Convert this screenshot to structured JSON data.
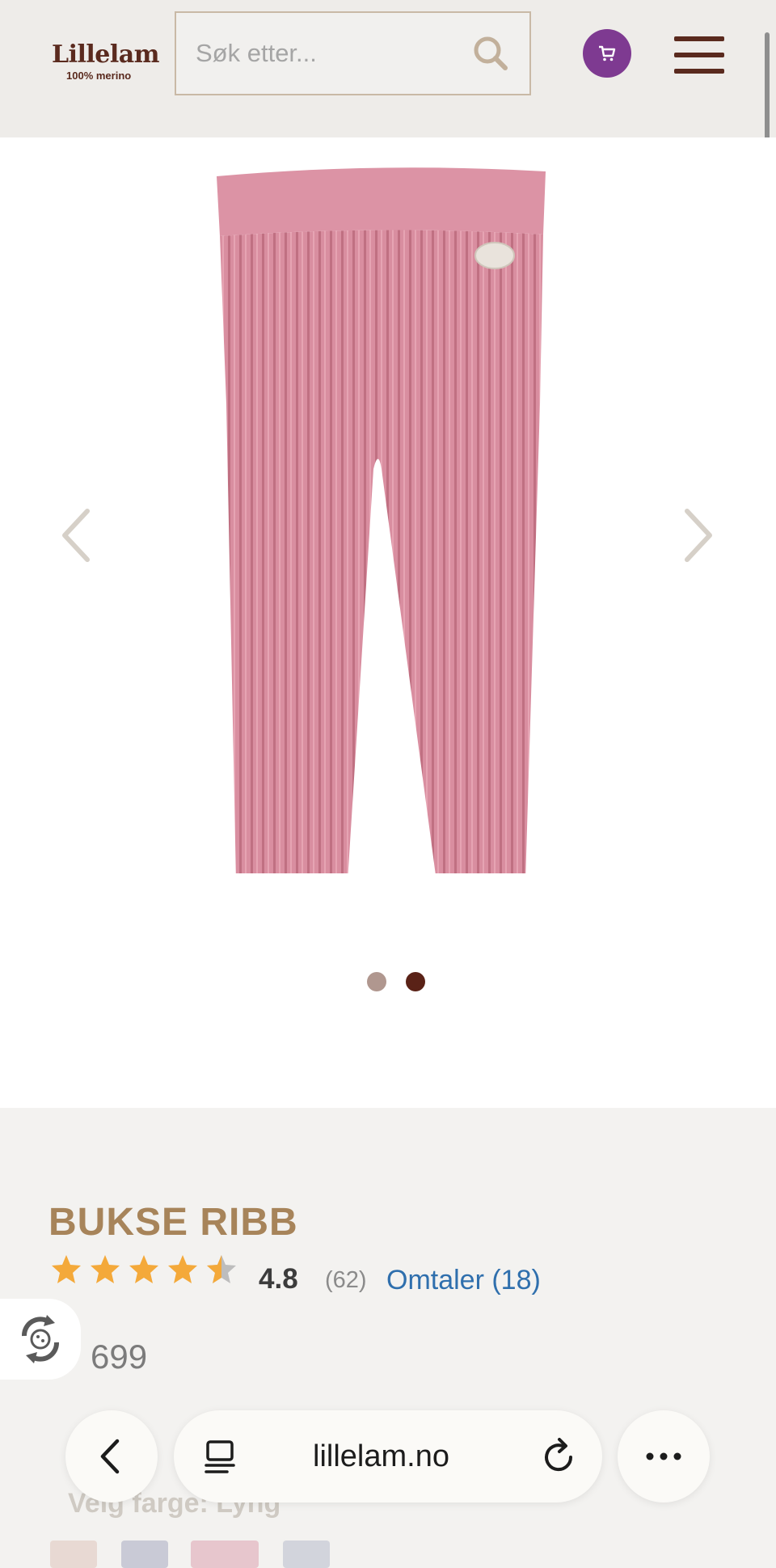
{
  "header": {
    "logo_name": "Lillelam",
    "logo_tagline": "100% merino",
    "search_placeholder": "Søk etter...",
    "accent_color": "#7e3a91",
    "brand_color": "#5a2a1e"
  },
  "gallery": {
    "slide_count": 2,
    "active_slide": 2
  },
  "product": {
    "title": "BUKSE RIBB",
    "rating": "4.8",
    "rating_value": 4.8,
    "rating_count": "(62)",
    "reviews_link": "Omtaler (18)",
    "price": "699",
    "color_label": "Velg farge: Lyng",
    "title_color": "#a7845a"
  },
  "browser": {
    "url": "lillelam.no"
  },
  "icons": [
    "search-icon",
    "cart-icon",
    "menu-icon",
    "chevron-left-icon",
    "chevron-right-icon",
    "cookie-settings-icon",
    "back-icon",
    "tabs-icon",
    "reload-icon",
    "more-icon",
    "star-icon"
  ]
}
